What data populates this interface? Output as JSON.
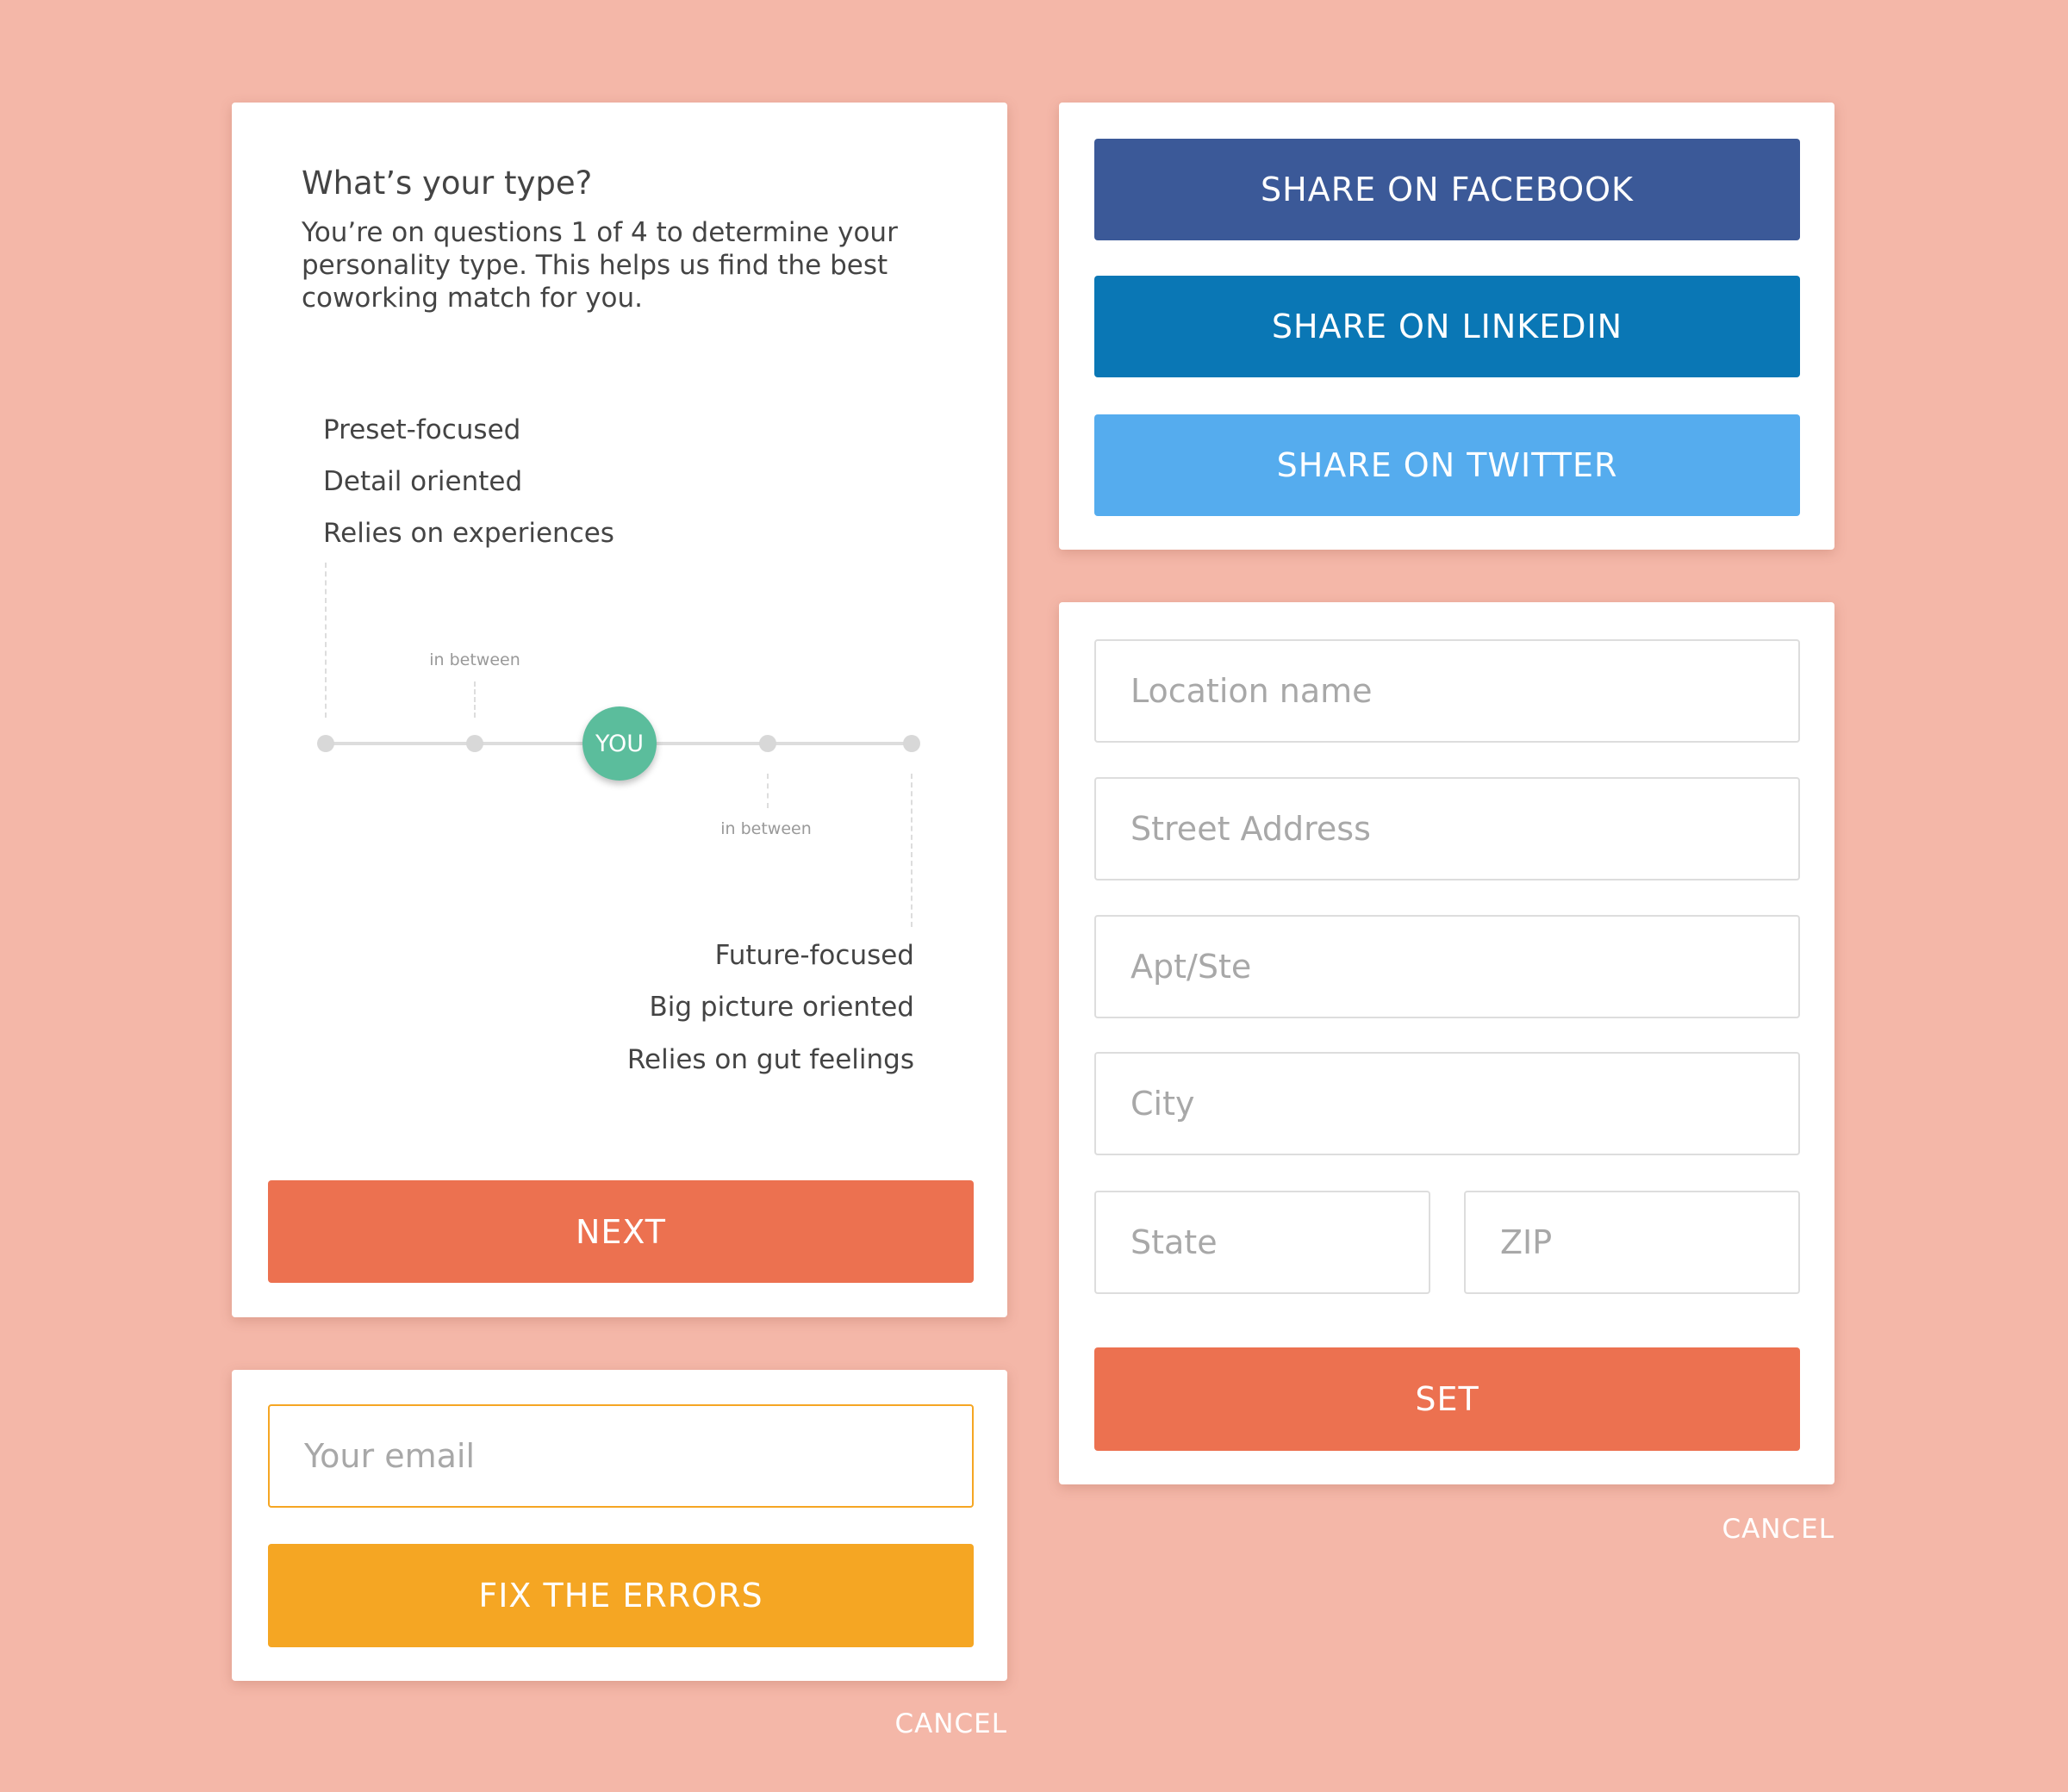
{
  "colors": {
    "background": "#f4b7a8",
    "primary": "#ec7150",
    "warning": "#f5a623",
    "facebook": "#3b5998",
    "linkedin": "#0a77b5",
    "twitter": "#55acee",
    "you_marker": "#5bbd9c"
  },
  "quiz": {
    "title": "What’s your type?",
    "description": "You’re on questions 1 of 4 to determine your personality type. This helps us find the best coworking match for you.",
    "left_traits": [
      "Preset-focused",
      "Detail oriented",
      "Relies on experiences"
    ],
    "right_traits": [
      "Future-focused",
      "Big picture oriented",
      "Relies on gut feelings"
    ],
    "scale": {
      "steps": 5,
      "selected_step": 3,
      "marker_label": "YOU",
      "between_labels": [
        "in between",
        "in between"
      ]
    },
    "next_label": "NEXT"
  },
  "email_form": {
    "placeholder": "Your email",
    "value": "",
    "button_label": "FIX THE ERRORS",
    "cancel_label": "CANCEL"
  },
  "share": {
    "facebook": "SHARE ON FACEBOOK",
    "linkedin": "SHARE ON LINKEDIN",
    "twitter": "SHARE ON TWITTER"
  },
  "location_form": {
    "placeholders": {
      "location": "Location name",
      "street": "Street Address",
      "apt": "Apt/Ste",
      "city": "City",
      "state": "State",
      "zip": "ZIP"
    },
    "set_label": "SET",
    "cancel_label": "CANCEL"
  }
}
